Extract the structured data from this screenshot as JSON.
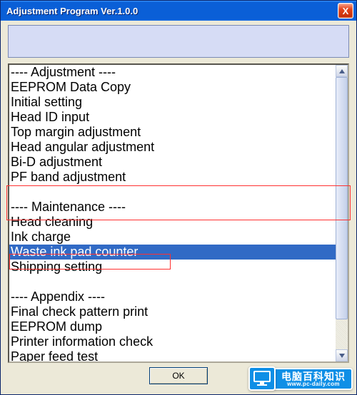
{
  "window": {
    "title": "Adjustment Program Ver.1.0.0",
    "close_label": "X"
  },
  "list": {
    "items": [
      {
        "text": "---- Adjustment ----",
        "type": "header"
      },
      {
        "text": "EEPROM Data Copy",
        "type": "item"
      },
      {
        "text": "Initial setting",
        "type": "item"
      },
      {
        "text": "Head ID input",
        "type": "item"
      },
      {
        "text": "Top margin adjustment",
        "type": "item"
      },
      {
        "text": "Head angular adjustment",
        "type": "item"
      },
      {
        "text": "Bi-D adjustment",
        "type": "item"
      },
      {
        "text": "PF band adjustment",
        "type": "item"
      },
      {
        "text": "",
        "type": "blank"
      },
      {
        "text": "---- Maintenance ----",
        "type": "header"
      },
      {
        "text": "Head cleaning",
        "type": "item"
      },
      {
        "text": "Ink charge",
        "type": "item"
      },
      {
        "text": "Waste ink pad counter",
        "type": "item",
        "selected": true
      },
      {
        "text": "Shipping setting",
        "type": "item"
      },
      {
        "text": "",
        "type": "blank"
      },
      {
        "text": "---- Appendix ----",
        "type": "header"
      },
      {
        "text": "Final check pattern print",
        "type": "item"
      },
      {
        "text": "EEPROM dump",
        "type": "item"
      },
      {
        "text": "Printer information check",
        "type": "item"
      },
      {
        "text": "Paper feed test",
        "type": "item"
      }
    ]
  },
  "buttons": {
    "ok": "OK"
  },
  "watermark": {
    "cn": "电脑百科知识",
    "en": "www.pc-daily.com"
  }
}
